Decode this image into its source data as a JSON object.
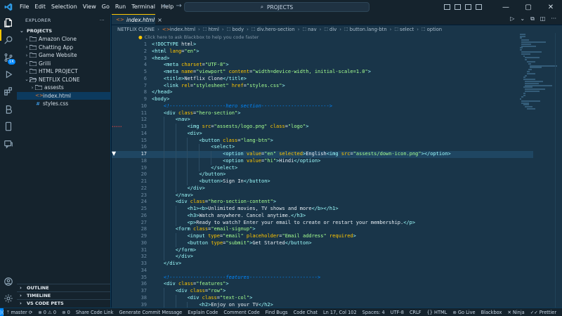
{
  "menu": [
    "File",
    "Edit",
    "Selection",
    "View",
    "Go",
    "Run",
    "Terminal",
    "Help"
  ],
  "command_center": {
    "label": "PROJECTS"
  },
  "sidebar": {
    "title": "EXPLORER",
    "section": "PROJECTS",
    "tree": [
      {
        "label": "Amazon Clone",
        "kind": "folder",
        "depth": 1,
        "open": false
      },
      {
        "label": "Chatting App",
        "kind": "folder",
        "depth": 1,
        "open": false
      },
      {
        "label": "Game Website",
        "kind": "folder",
        "depth": 1,
        "open": false
      },
      {
        "label": "Grilli",
        "kind": "folder",
        "depth": 1,
        "open": false
      },
      {
        "label": "HTML PROJECT",
        "kind": "folder",
        "depth": 1,
        "open": false
      },
      {
        "label": "NETFLIX CLONE",
        "kind": "folder",
        "depth": 1,
        "open": true
      },
      {
        "label": "assests",
        "kind": "folder",
        "depth": 2,
        "open": false
      },
      {
        "label": "index.html",
        "kind": "html",
        "depth": 2,
        "selected": true
      },
      {
        "label": "styles.css",
        "kind": "css",
        "depth": 2
      }
    ],
    "bottom_sections": [
      "OUTLINE",
      "TIMELINE",
      "VS CODE PETS"
    ]
  },
  "tab": {
    "label": "index.html"
  },
  "breadcrumb": [
    "NETFLIX CLONE",
    "index.html",
    "html",
    "body",
    "div.hero-section",
    "nav",
    "div",
    "button.lang-btn",
    "select",
    "option"
  ],
  "editor": {
    "hint": "Click here to ask Blackbox to help you code faster",
    "current_line": 17,
    "gutter_mark_label": "•••••",
    "lines": [
      "<!DOCTYPE html>",
      "<html lang=\"en\">",
      "<head>",
      "    <meta charset=\"UTF-8\">",
      "    <meta name=\"viewport\" content=\"width=device-width, initial-scale=1.0\">",
      "    <title>Netflix Clone</title>",
      "    <link rel=\"stylesheet\" href=\"styles.css\">",
      "</head>",
      "<body>",
      "    <!-------------------hero section----------------------->",
      "    <div class=\"hero-section\">",
      "        <nav>",
      "            <img src=\"assests/logo.png\" class=\"logo\">",
      "            <div>",
      "                <button class=\"lang-btn\">",
      "                    <select>",
      "                        <option value=\"en\" selected>English<img src=\"assests/down-icon.png\"></option>",
      "                        <option value=\"hi\">Hindi</option>",
      "                    </select>",
      "                </button>",
      "                <button>Sign In</button>",
      "            </div>",
      "        </nav>",
      "        <div class=\"hero-section-content\">",
      "            <h1><b>Unlimited movies, TV shows and more</b></h1>",
      "            <h3>Watch anywhere. Cancel anytime.</h3>",
      "            <p>Ready to watch? Enter your email to create or restart your membership.</p>",
      "        <form class=\"email-signup\">",
      "            <input type=\"email\" placeholder=\"Email address\" required>",
      "            <button type=\"submit\">Get Started</button>",
      "        </form>",
      "        </div>",
      "    </div>",
      "",
      "    <!-------------------features----------------------->",
      "    <div class=\"features\">",
      "        <div class=\"row\">",
      "            <div class=\"text-col\">",
      "                <h2>Enjoy on your TV</h2>"
    ]
  },
  "statusbar": {
    "branch": "master",
    "sync": "⟳",
    "errors": "0",
    "warnings": "0",
    "ports": "0",
    "left_items": [
      "Share Code Link",
      "Generate Commit Message",
      "Explain Code",
      "Comment Code",
      "Find Bugs",
      "Code Chat"
    ],
    "position": "Ln 17, Col 102",
    "spaces": "Spaces: 4",
    "encoding": "UTF-8",
    "eol": "CRLF",
    "language": "HTML",
    "go_live": "Go Live",
    "blackbox": "Blackbox",
    "ninja": "Ninja",
    "prettier": "Prettier"
  },
  "colors": {
    "editor_bg": "#193549",
    "sidebar_bg": "#15232d",
    "accent": "#ffc600",
    "tag": "#9effff",
    "attr": "#ffc600",
    "string": "#a5ff90",
    "comment": "#0088ff"
  }
}
